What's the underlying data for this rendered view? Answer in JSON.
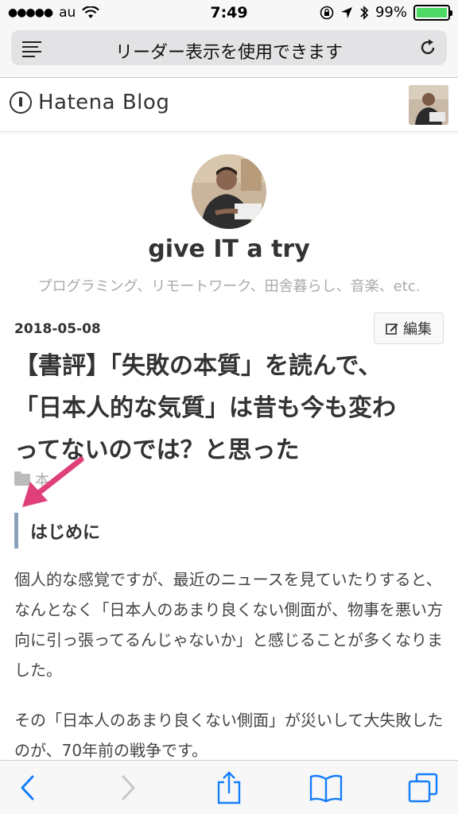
{
  "status_bar": {
    "carrier": "au",
    "time": "7:49",
    "battery_percent": "99%",
    "battery_level": 0.99
  },
  "browser": {
    "url_text": "リーダー表示を使用できます"
  },
  "header": {
    "logo_text": "Hatena Blog"
  },
  "blog": {
    "title": "give IT a try",
    "description": "プログラミング、リモートワーク、田舎暮らし、音楽、etc."
  },
  "entry": {
    "date": "2018-05-08",
    "edit_label": "編集",
    "title_lines": [
      "【書評】「失敗の本質」を読んで、",
      "「日本人的な気質」は昔も今も変わ",
      "ってないのでは？と思った"
    ],
    "category": "本",
    "section_heading": "はじめに",
    "paragraphs": [
      "個人的な感覚ですが、最近のニュースを見ていたりすると、なんとなく「日本人のあまり良くない側面が、物事を悪い方向に引っ張ってるんじゃないか」と感じることが多くなりました。",
      "その「日本人のあまり良くない側面」が災いして大失敗したのが、70年前の戦争です。"
    ]
  },
  "colors": {
    "accent_arrow": "#e0407a",
    "heading_bar": "#8aa0bb",
    "ios_blue": "#157efb"
  },
  "icons": {
    "back": "chevron-left-icon",
    "forward": "chevron-right-icon",
    "share": "share-icon",
    "bookmarks": "book-icon",
    "tabs": "tabs-icon"
  }
}
